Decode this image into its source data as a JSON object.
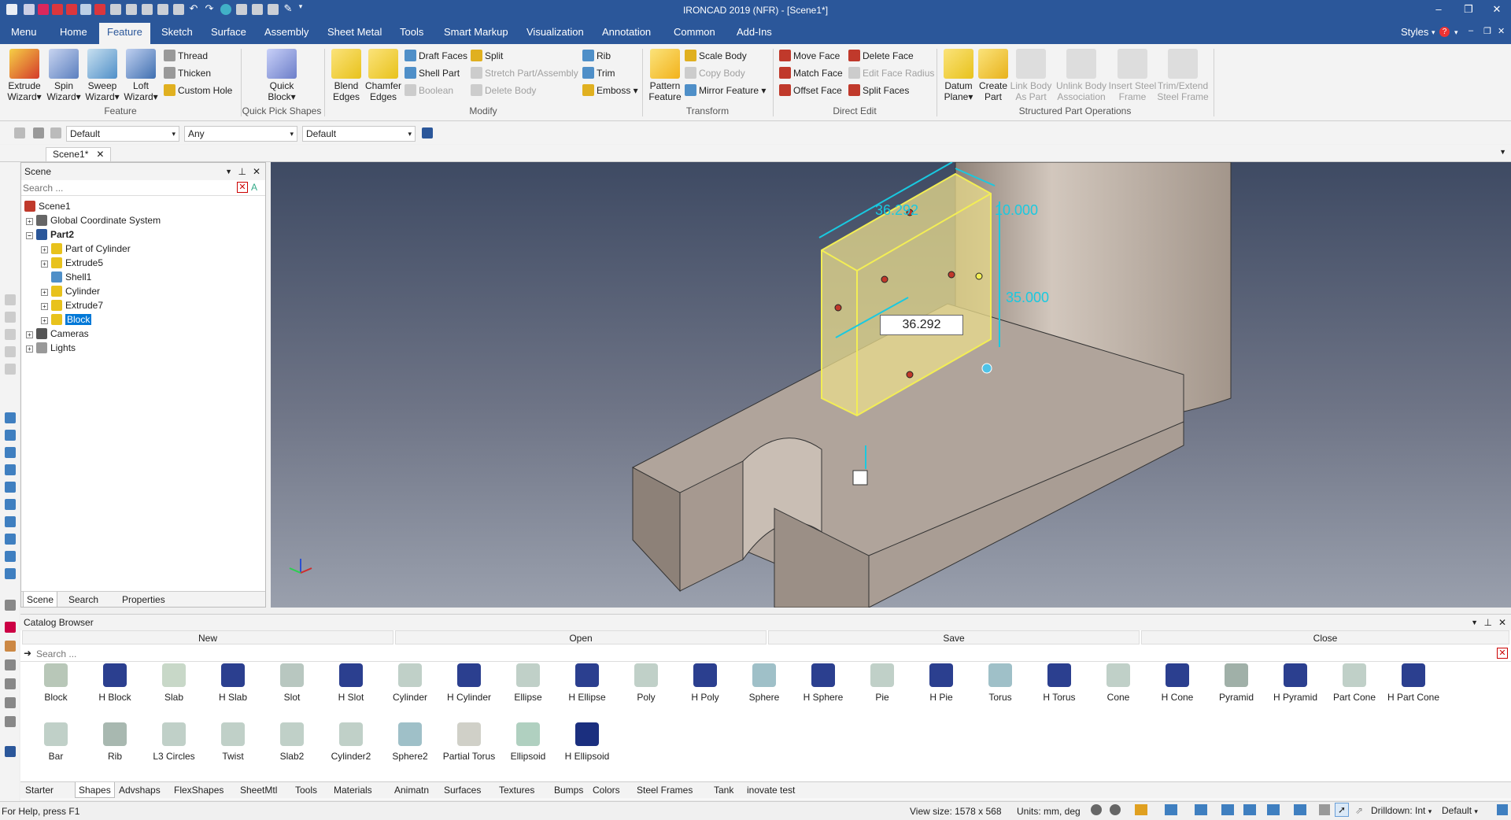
{
  "app": {
    "title": "IRONCAD 2019 (NFR) - [Scene1*]",
    "styles_label": "Styles"
  },
  "menu": [
    {
      "label": "Menu"
    },
    {
      "label": "Home"
    },
    {
      "label": "Feature"
    },
    {
      "label": "Sketch"
    },
    {
      "label": "Surface"
    },
    {
      "label": "Assembly"
    },
    {
      "label": "Sheet Metal"
    },
    {
      "label": "Tools"
    },
    {
      "label": "Smart Markup"
    },
    {
      "label": "Visualization"
    },
    {
      "label": "Annotation"
    },
    {
      "label": "Common"
    },
    {
      "label": "Add-Ins"
    }
  ],
  "ribbon": {
    "big": [
      {
        "l1": "Extrude",
        "l2": "Wizard▾",
        "color": "#d43b2a"
      },
      {
        "l1": "Spin",
        "l2": "Wizard▾",
        "color": "#5b7fbf"
      },
      {
        "l1": "Sweep",
        "l2": "Wizard▾",
        "color": "#4f8fc8"
      },
      {
        "l1": "Loft",
        "l2": "Wizard▾",
        "color": "#3f6fb0"
      },
      {
        "l1": "Quick",
        "l2": "Block▾",
        "color": "#6c7ec9"
      },
      {
        "l1": "Blend",
        "l2": "Edges",
        "color": "#e8c21c"
      },
      {
        "l1": "Chamfer",
        "l2": "Edges",
        "color": "#e8c21c"
      },
      {
        "l1": "Pattern",
        "l2": "Feature",
        "color": "#f2b21c"
      },
      {
        "l1": "Datum",
        "l2": "Plane▾",
        "color": "#e8c21c"
      },
      {
        "l1": "Create",
        "l2": "Part",
        "color": "#e8b21c"
      },
      {
        "l1": "Link Body",
        "l2": "As Part",
        "color": "#c8c8c8"
      },
      {
        "l1": "Unlink Body",
        "l2": "Association",
        "color": "#c8c8c8"
      },
      {
        "l1": "Insert Steel",
        "l2": "Frame",
        "color": "#c8c8c8"
      },
      {
        "l1": "Trim/Extend",
        "l2": "Steel Frame",
        "color": "#c8c8c8"
      }
    ],
    "small": [
      {
        "label": "Thread",
        "color": "#777"
      },
      {
        "label": "Thicken",
        "color": "#777"
      },
      {
        "label": "Custom Hole",
        "color": "#e0b020"
      },
      {
        "label": "Draft Faces",
        "color": "#4f8fc8"
      },
      {
        "label": "Shell Part",
        "color": "#4f8fc8"
      },
      {
        "label": "Boolean",
        "color": "#bbb"
      },
      {
        "label": "Split",
        "color": "#e0b020"
      },
      {
        "label": "Stretch Part/Assembly",
        "color": "#bbb"
      },
      {
        "label": "Delete Body",
        "color": "#bbb"
      },
      {
        "label": "Rib",
        "color": "#4f8fc8"
      },
      {
        "label": "Trim",
        "color": "#4f8fc8"
      },
      {
        "label": "Emboss ▾",
        "color": "#e0b020"
      },
      {
        "label": "Scale Body",
        "color": "#e0b020"
      },
      {
        "label": "Copy Body",
        "color": "#bbb"
      },
      {
        "label": "Mirror Feature ▾",
        "color": "#4f8fc8"
      },
      {
        "label": "Move Face",
        "color": "#c0392b"
      },
      {
        "label": "Match Face",
        "color": "#c0392b"
      },
      {
        "label": "Offset Face",
        "color": "#c0392b"
      },
      {
        "label": "Delete Face",
        "color": "#c0392b"
      },
      {
        "label": "Edit Face Radius",
        "color": "#bbb"
      },
      {
        "label": "Split Faces",
        "color": "#c0392b"
      }
    ],
    "groups": [
      "Feature",
      "Quick Pick Shapes",
      "Modify",
      "Transform",
      "Direct Edit",
      "Structured Part Operations"
    ]
  },
  "toolbar2": {
    "combo1": "Default",
    "combo2": "Any",
    "combo3": "Default"
  },
  "doc_tab": "Scene1*",
  "scene_panel": {
    "title": "Scene",
    "search_placeholder": "Search ...",
    "tree": [
      {
        "label": "Scene1",
        "color": "#c0392b"
      },
      {
        "label": "Global Coordinate System",
        "color": "#444"
      },
      {
        "label": "Part2",
        "color": "#2b579a"
      },
      {
        "label": "Part of Cylinder",
        "color": "#e8c21c"
      },
      {
        "label": "Extrude5",
        "color": "#e8c21c"
      },
      {
        "label": "Shell1",
        "color": "#4f8fc8"
      },
      {
        "label": "Cylinder",
        "color": "#e8c21c"
      },
      {
        "label": "Extrude7",
        "color": "#e8c21c"
      },
      {
        "label": "Block",
        "color": "#e8c21c"
      },
      {
        "label": "Cameras",
        "color": "#444"
      },
      {
        "label": "Lights",
        "color": "#444"
      }
    ],
    "tabs": [
      "Scene",
      "Search",
      "Properties"
    ]
  },
  "viewport": {
    "dim_width": "36.292",
    "dim_depth": "10.000",
    "dim_height": "35.000",
    "edit_value": "36.292"
  },
  "catalog": {
    "title": "Catalog Browser",
    "buttons": [
      "New",
      "Open",
      "Save",
      "Close"
    ],
    "search_placeholder": "Search ...",
    "shapes_row1": [
      {
        "label": "Block",
        "color": "#b8c7b8"
      },
      {
        "label": "H Block",
        "color": "#2b3f8f"
      },
      {
        "label": "Slab",
        "color": "#c8d8c8"
      },
      {
        "label": "H Slab",
        "color": "#2b3f8f"
      },
      {
        "label": "Slot",
        "color": "#b8c7c0"
      },
      {
        "label": "H Slot",
        "color": "#2b3f8f"
      },
      {
        "label": "Cylinder",
        "color": "#c0d0c8"
      },
      {
        "label": "H Cylinder",
        "color": "#2b3f8f"
      },
      {
        "label": "Ellipse",
        "color": "#c0d0c8"
      },
      {
        "label": "H Ellipse",
        "color": "#2b3f8f"
      },
      {
        "label": "Poly",
        "color": "#c0d0c8"
      },
      {
        "label": "H Poly",
        "color": "#2b3f8f"
      },
      {
        "label": "Sphere",
        "color": "#9fc0c8"
      },
      {
        "label": "H Sphere",
        "color": "#2b3f8f"
      },
      {
        "label": "Pie",
        "color": "#c0d0c8"
      },
      {
        "label": "H Pie",
        "color": "#2b3f8f"
      },
      {
        "label": "Torus",
        "color": "#9fc0c8"
      },
      {
        "label": "H Torus",
        "color": "#2b3f8f"
      },
      {
        "label": "Cone",
        "color": "#c0d0c8"
      },
      {
        "label": "H Cone",
        "color": "#2b3f8f"
      },
      {
        "label": "Pyramid",
        "color": "#a0b0a8"
      },
      {
        "label": "H Pyramid",
        "color": "#2b3f8f"
      },
      {
        "label": "Part Cone",
        "color": "#c0d0c8"
      },
      {
        "label": "H Part Cone",
        "color": "#2b3f8f"
      }
    ],
    "shapes_row2": [
      {
        "label": "Bar",
        "color": "#c0d0c8"
      },
      {
        "label": "Rib",
        "color": "#a8b8b0"
      },
      {
        "label": "L3 Circles",
        "color": "#c0d0c8"
      },
      {
        "label": "Twist",
        "color": "#c0d0c8"
      },
      {
        "label": "Slab2",
        "color": "#c0d0c8"
      },
      {
        "label": "Cylinder2",
        "color": "#c0d0c8"
      },
      {
        "label": "Sphere2",
        "color": "#9fc0c8"
      },
      {
        "label": "Partial Torus",
        "color": "#d0d0c8"
      },
      {
        "label": "Ellipsoid",
        "color": "#b0d0c0"
      },
      {
        "label": "H Ellipsoid",
        "color": "#1b2f7f"
      }
    ],
    "tabs": [
      "Starter",
      "Shapes",
      "Advshaps",
      "FlexShapes",
      "SheetMtl",
      "Tools",
      "Materials",
      "Animatn",
      "Surfaces",
      "Textures",
      "Bumps",
      "Colors",
      "Steel Frames",
      "Tank",
      "inovate test"
    ]
  },
  "status": {
    "help": "For Help, press F1",
    "view_size": "View size: 1578 x  568",
    "units": "Units: mm, deg",
    "drilldown": "Drilldown: Int",
    "default": "Default"
  }
}
